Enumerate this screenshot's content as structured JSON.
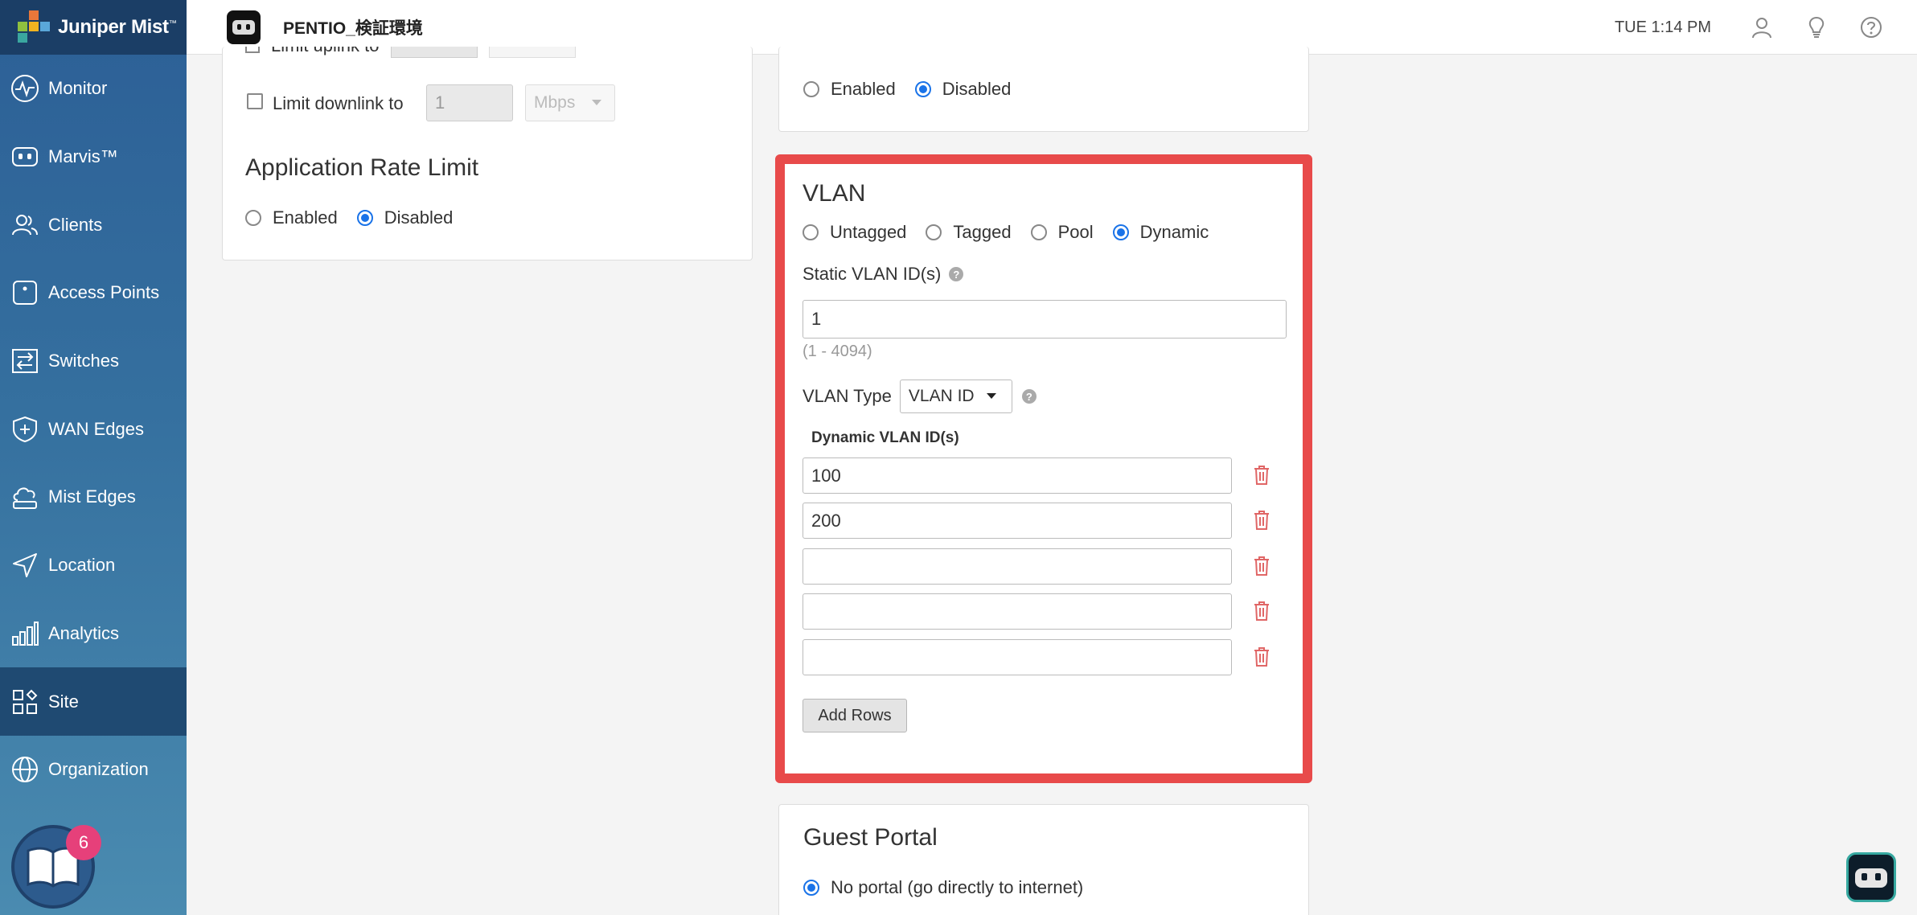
{
  "app": {
    "logo_text": "Juniper Mist",
    "logo_tm": "™"
  },
  "colors": {
    "accent": "#1a73e8",
    "highlight_border": "#e84a4a",
    "sidebar_top": "#2c5f96",
    "sidebar_bottom": "#4a8bb0",
    "badge": "#e6407a"
  },
  "sidebar": {
    "items": [
      {
        "label": "Monitor",
        "icon": "pulse-icon"
      },
      {
        "label": "Marvis™",
        "icon": "marvis-icon"
      },
      {
        "label": "Clients",
        "icon": "clients-icon"
      },
      {
        "label": "Access Points",
        "icon": "access-point-icon"
      },
      {
        "label": "Switches",
        "icon": "switch-icon"
      },
      {
        "label": "WAN Edges",
        "icon": "wan-edge-icon"
      },
      {
        "label": "Mist Edges",
        "icon": "cloud-icon"
      },
      {
        "label": "Location",
        "icon": "location-arrow-icon"
      },
      {
        "label": "Analytics",
        "icon": "bar-chart-icon"
      },
      {
        "label": "Site",
        "icon": "site-icon",
        "active": true
      },
      {
        "label": "Organization",
        "icon": "globe-icon"
      }
    ],
    "help_count": "6"
  },
  "topbar": {
    "org_name": "PENTIO_検証環境",
    "clock": "TUE 1:14 PM"
  },
  "left_panel": {
    "limit_uplink_label": "Limit uplink to",
    "limit_downlink_label": "Limit downlink to",
    "downlink_value": "1",
    "downlink_unit": "Mbps",
    "app_rate_title": "Application Rate Limit",
    "enabled_label": "Enabled",
    "disabled_label": "Disabled"
  },
  "top_right_panel": {
    "enabled_label": "Enabled",
    "disabled_label": "Disabled"
  },
  "vlan": {
    "title": "VLAN",
    "options": [
      "Untagged",
      "Tagged",
      "Pool",
      "Dynamic"
    ],
    "selected": "Dynamic",
    "static_label": "Static VLAN ID(s)",
    "static_value": "1",
    "static_hint": "(1 - 4094)",
    "type_label": "VLAN Type",
    "type_value": "VLAN ID",
    "dynamic_label": "Dynamic VLAN ID(s)",
    "dynamic_rows": [
      "100",
      "200",
      "",
      "",
      ""
    ],
    "add_rows": "Add Rows"
  },
  "guest_portal": {
    "title": "Guest Portal",
    "option_label": "No portal (go directly to internet)"
  }
}
